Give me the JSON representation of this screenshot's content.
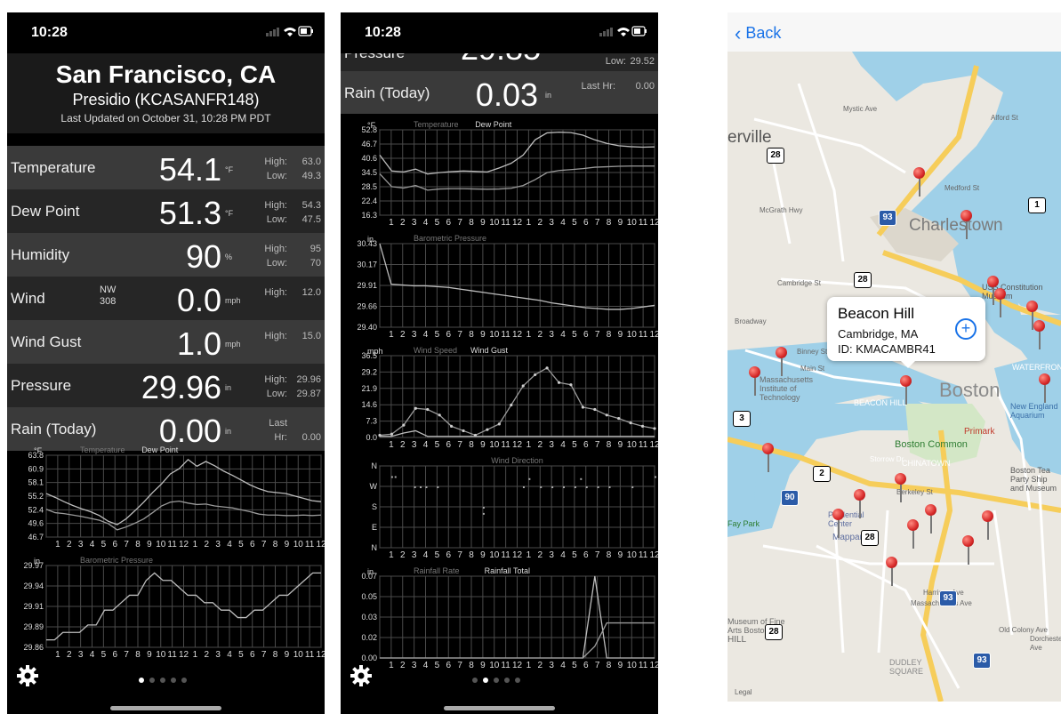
{
  "phone1": {
    "status_time": "10:28",
    "city": "San Francisco, CA",
    "station": "Presidio (KCASANFR148)",
    "updated": "Last Updated on October 31, 10:28 PM PDT",
    "rows": [
      {
        "label": "Temperature",
        "value": "54.1",
        "unit": "°F",
        "k1": "High:",
        "v1": "63.0",
        "k2": "Low:",
        "v2": "49.3"
      },
      {
        "label": "Dew Point",
        "value": "51.3",
        "unit": "°F",
        "k1": "High:",
        "v1": "54.3",
        "k2": "Low:",
        "v2": "47.5"
      },
      {
        "label": "Humidity",
        "value": "90",
        "unit": "%",
        "k1": "High:",
        "v1": "95",
        "k2": "Low:",
        "v2": "70"
      },
      {
        "label": "Wind",
        "dir": "NW",
        "deg": "308",
        "value": "0.0",
        "unit": "mph",
        "k1": "High:",
        "v1": "12.0",
        "k2": "",
        "v2": ""
      },
      {
        "label": "Wind Gust",
        "value": "1.0",
        "unit": "mph",
        "k1": "High:",
        "v1": "15.0",
        "k2": "",
        "v2": ""
      },
      {
        "label": "Pressure",
        "value": "29.96",
        "unit": "in",
        "k1": "High:",
        "v1": "29.96",
        "k2": "Low:",
        "v2": "29.87"
      },
      {
        "label": "Rain (Today)",
        "value": "0.00",
        "unit": "in",
        "k1": "Last Hr:",
        "v1": "0.00",
        "k2": "",
        "v2": ""
      }
    ]
  },
  "phone2": {
    "status_time": "10:28",
    "pressure_low_key": "Low:",
    "pressure_low_value": "29.52",
    "rain_label": "Rain (Today)",
    "rain_value": "0.03",
    "rain_unit": "in",
    "rain_lasthr_key": "Last Hr:",
    "rain_lasthr_value": "0.00"
  },
  "map": {
    "back_label": "Back",
    "callout_title": "Beacon Hill",
    "callout_city": "Cambridge, MA",
    "callout_id": "ID: KMACAMBR41",
    "labels": [
      {
        "text": "erville",
        "cls": "big"
      },
      {
        "text": "Charlestown",
        "cls": "big"
      },
      {
        "text": "Boston",
        "cls": "city"
      },
      {
        "text": "BEACON HILL",
        "cls": "dist"
      },
      {
        "text": "Boston Common",
        "cls": "park"
      },
      {
        "text": "CHINATOWN",
        "cls": "dist"
      },
      {
        "text": "Massachusetts Institute of Technology",
        "cls": "poi"
      },
      {
        "text": "Mapparium",
        "cls": "poi"
      },
      {
        "text": "Primark",
        "cls": "poi"
      },
      {
        "text": "New England Aquarium",
        "cls": "poi"
      },
      {
        "text": "Boston Tea Party Ship and Museum",
        "cls": "poi"
      },
      {
        "text": "Museum of Fine Arts Boston",
        "cls": "poi"
      },
      {
        "text": "DUDLEY SQUARE",
        "cls": "dist"
      },
      {
        "text": "WATERFRONT",
        "cls": "dist"
      },
      {
        "text": "USS Constitution Museum",
        "cls": "poi"
      },
      {
        "text": "Cambridge St",
        "cls": "road"
      },
      {
        "text": "Main St",
        "cls": "road"
      },
      {
        "text": "Binney St",
        "cls": "road"
      },
      {
        "text": "Broadway",
        "cls": "road"
      },
      {
        "text": "Medford St",
        "cls": "road"
      },
      {
        "text": "McGrath Hwy",
        "cls": "road"
      },
      {
        "text": "Alford St",
        "cls": "road"
      },
      {
        "text": "Mystic Ave",
        "cls": "road"
      },
      {
        "text": "Storrow Dr",
        "cls": "road"
      },
      {
        "text": "Massachusetts Ave",
        "cls": "road"
      },
      {
        "text": "Harrison Ave",
        "cls": "road"
      },
      {
        "text": "Dorchester Ave",
        "cls": "road"
      },
      {
        "text": "Old Colony Ave",
        "cls": "road"
      },
      {
        "text": "Berkeley St",
        "cls": "road"
      },
      {
        "text": "Prudential Center",
        "cls": "poi"
      },
      {
        "text": "Fay Park",
        "cls": "park"
      },
      {
        "text": "HILL",
        "cls": "dist"
      },
      {
        "text": "Legal",
        "cls": "road"
      }
    ],
    "shields": [
      "28",
      "28",
      "28",
      "28",
      "2",
      "3",
      "1",
      "93",
      "93",
      "93",
      "90"
    ],
    "pin_count": 19
  },
  "colors": {
    "temp_line": "#d8d8d8",
    "grid": "#555555",
    "water": "#9fd0e8",
    "pin": "#d62828",
    "link": "#1a73e8"
  },
  "chart_data": [
    {
      "type": "line",
      "title": "",
      "series": [
        {
          "name": "Temperature",
          "values": [
            55.8,
            55.0,
            54.1,
            53.3,
            52.6,
            52.0,
            51.2,
            50.0,
            49.3,
            50.5,
            52.2,
            54.0,
            56.0,
            57.8,
            59.9,
            61.0,
            62.9,
            61.5,
            62.5,
            61.6,
            60.5,
            59.6,
            58.6,
            57.6,
            56.8,
            56.2,
            56.0,
            55.8,
            55.3,
            54.8,
            54.3,
            54.1
          ]
        },
        {
          "name": "Dew Point",
          "values": [
            52.5,
            51.8,
            51.6,
            51.3,
            51.0,
            50.6,
            50.2,
            49.5,
            48.2,
            48.8,
            49.6,
            50.5,
            51.8,
            53.2,
            54.0,
            54.2,
            53.8,
            53.5,
            53.6,
            53.2,
            53.0,
            52.8,
            52.4,
            52.0,
            51.5,
            51.3,
            51.3,
            51.2,
            51.2,
            51.3,
            51.2,
            51.3
          ]
        }
      ],
      "ylabel": "°F",
      "yticks": [
        "63.8",
        "60.9",
        "58.1",
        "55.2",
        "52.4",
        "49.6",
        "46.7"
      ],
      "ylim": [
        46.7,
        63.8
      ],
      "xticks": [
        "1",
        "2",
        "3",
        "4",
        "5",
        "6",
        "7",
        "8",
        "9",
        "10",
        "11",
        "12",
        "1",
        "2",
        "3",
        "4",
        "5",
        "6",
        "7",
        "8",
        "9",
        "10",
        "11",
        "12"
      ]
    },
    {
      "type": "line",
      "title": "",
      "series": [
        {
          "name": "Barometric Pressure",
          "values": [
            29.87,
            29.87,
            29.88,
            29.88,
            29.88,
            29.89,
            29.89,
            29.91,
            29.91,
            29.92,
            29.93,
            29.93,
            29.95,
            29.96,
            29.95,
            29.95,
            29.94,
            29.93,
            29.93,
            29.92,
            29.92,
            29.91,
            29.91,
            29.9,
            29.9,
            29.91,
            29.91,
            29.92,
            29.93,
            29.93,
            29.94,
            29.95,
            29.96,
            29.96
          ]
        }
      ],
      "ylabel": "in",
      "yticks": [
        "29.97",
        "29.94",
        "29.91",
        "29.89",
        "29.86"
      ],
      "ylim": [
        29.86,
        29.97
      ],
      "xticks": [
        "1",
        "2",
        "3",
        "4",
        "5",
        "6",
        "7",
        "8",
        "9",
        "10",
        "11",
        "12",
        "1",
        "2",
        "3",
        "4",
        "5",
        "6",
        "7",
        "8",
        "9",
        "10",
        "11",
        "12"
      ]
    },
    {
      "type": "line",
      "title": "",
      "series": [
        {
          "name": "Temperature",
          "values": [
            42.0,
            35.2,
            34.8,
            36.0,
            33.9,
            34.5,
            34.9,
            35.2,
            35.0,
            34.8,
            36.5,
            38.5,
            42.0,
            48.5,
            51.5,
            51.8,
            51.6,
            50.5,
            48.5,
            47.0,
            46.0,
            45.6,
            45.4,
            45.5
          ]
        },
        {
          "name": "Dew Point",
          "values": [
            34.0,
            28.5,
            27.9,
            29.0,
            27.0,
            27.5,
            27.6,
            27.6,
            27.5,
            27.4,
            27.5,
            27.8,
            29.0,
            31.5,
            34.5,
            35.4,
            35.8,
            36.2,
            36.8,
            37.0,
            37.2,
            37.3,
            37.3,
            37.3
          ]
        }
      ],
      "ylabel": "°F",
      "yticks": [
        "52.8",
        "46.7",
        "40.6",
        "34.5",
        "28.5",
        "22.4",
        "16.3"
      ],
      "ylim": [
        16.3,
        52.8
      ],
      "xticks": [
        "1",
        "2",
        "3",
        "4",
        "5",
        "6",
        "7",
        "8",
        "9",
        "10",
        "11",
        "12",
        "1",
        "2",
        "3",
        "4",
        "5",
        "6",
        "7",
        "8",
        "9",
        "10",
        "11",
        "12"
      ]
    },
    {
      "type": "line",
      "title": "",
      "series": [
        {
          "name": "Barometric Pressure",
          "values": [
            30.43,
            29.93,
            29.92,
            29.91,
            29.91,
            29.9,
            29.89,
            29.87,
            29.85,
            29.83,
            29.81,
            29.79,
            29.77,
            29.75,
            29.73,
            29.7,
            29.68,
            29.66,
            29.64,
            29.63,
            29.62,
            29.62,
            29.63,
            29.65,
            29.67
          ]
        }
      ],
      "ylabel": "in",
      "yticks": [
        "30.43",
        "30.17",
        "29.91",
        "29.66",
        "29.40"
      ],
      "ylim": [
        29.4,
        30.43
      ],
      "xticks": [
        "1",
        "2",
        "3",
        "4",
        "5",
        "6",
        "7",
        "8",
        "9",
        "10",
        "11",
        "12",
        "1",
        "2",
        "3",
        "4",
        "5",
        "6",
        "7",
        "8",
        "9",
        "10",
        "11",
        "12"
      ]
    },
    {
      "type": "line",
      "title": "",
      "series": [
        {
          "name": "Wind Speed",
          "values": [
            0.5,
            0.5,
            2.0,
            3.0,
            0.5,
            0.5,
            0.5,
            0.5,
            0.5,
            0.5,
            0.5,
            0.5,
            0.5,
            0.5,
            0.5,
            0.5,
            0.5,
            0.5,
            0.5,
            0.5,
            0.5,
            0.5,
            0.5,
            0.5
          ]
        },
        {
          "name": "Wind Gust",
          "values": [
            1.0,
            1.5,
            5.5,
            13.0,
            12.5,
            10.0,
            5.0,
            3.0,
            1.0,
            3.5,
            6.0,
            14.5,
            23.0,
            28.0,
            31.0,
            24.5,
            23.5,
            13.5,
            12.5,
            10.0,
            8.5,
            6.5,
            5.0,
            4.0
          ]
        }
      ],
      "ylabel": "mph",
      "yticks": [
        "36.5",
        "29.2",
        "21.9",
        "14.6",
        "7.3",
        "0.0"
      ],
      "ylim": [
        0,
        36.5
      ],
      "xticks": [
        "1",
        "2",
        "3",
        "4",
        "5",
        "6",
        "7",
        "8",
        "9",
        "10",
        "11",
        "12",
        "1",
        "2",
        "3",
        "4",
        "5",
        "6",
        "7",
        "8",
        "9",
        "10",
        "11",
        "12"
      ]
    },
    {
      "type": "scatter",
      "title": "Wind Direction",
      "yticks": [
        "N",
        "W",
        "S",
        "E",
        "N"
      ],
      "xticks": [
        "1",
        "2",
        "3",
        "4",
        "5",
        "6",
        "7",
        "8",
        "9",
        "10",
        "11",
        "12",
        "1",
        "2",
        "3",
        "4",
        "5",
        "6",
        "7",
        "8",
        "9",
        "10",
        "11",
        "12"
      ]
    },
    {
      "type": "line",
      "title": "",
      "series": [
        {
          "name": "Rainfall Rate",
          "values": [
            0,
            0,
            0,
            0,
            0,
            0,
            0,
            0,
            0,
            0,
            0,
            0,
            0,
            0,
            0,
            0,
            0,
            0,
            0.07,
            0.0,
            0,
            0,
            0,
            0
          ]
        },
        {
          "name": "Rainfall Total",
          "values": [
            0,
            0,
            0,
            0,
            0,
            0,
            0,
            0,
            0,
            0,
            0,
            0,
            0,
            0,
            0,
            0,
            0,
            0,
            0.01,
            0.03,
            0.03,
            0.03,
            0.03,
            0.03
          ]
        }
      ],
      "ylabel": "in",
      "yticks": [
        "0.07",
        "0.05",
        "0.03",
        "0.02",
        "0.00"
      ],
      "ylim": [
        0,
        0.07
      ],
      "xticks": [
        "1",
        "2",
        "3",
        "4",
        "5",
        "6",
        "7",
        "8",
        "9",
        "10",
        "11",
        "12",
        "1",
        "2",
        "3",
        "4",
        "5",
        "6",
        "7",
        "8",
        "9",
        "10",
        "11",
        "12"
      ]
    }
  ]
}
